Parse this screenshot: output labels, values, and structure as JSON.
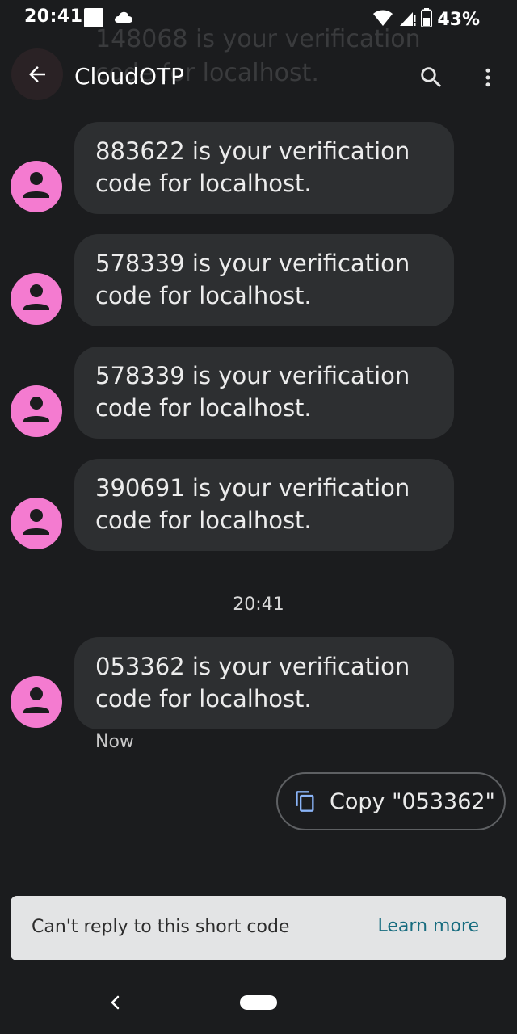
{
  "status_bar": {
    "time": "20:41",
    "battery_percent": "43%"
  },
  "background_notification": {
    "line1": "148068 is your verification",
    "line2": "code for localhost."
  },
  "app_bar": {
    "title": "CloudOTP"
  },
  "messages": [
    {
      "line1": "883622 is your verification",
      "line2": "code for localhost."
    },
    {
      "line1": "578339 is your verification",
      "line2": "code for localhost."
    },
    {
      "line1": "578339 is your verification",
      "line2": "code for localhost."
    },
    {
      "line1": "390691 is your verification",
      "line2": "code for localhost."
    },
    {
      "line1": "053362 is your verification",
      "line2": "code for localhost."
    }
  ],
  "timestamp_divider": "20:41",
  "last_message_status": "Now",
  "suggestion_chip": {
    "label": "Copy \"053362\""
  },
  "banner": {
    "text": "Can't reply to this short code",
    "link": "Learn more"
  },
  "colors": {
    "background": "#1b1c1e",
    "bubble": "#2d2f31",
    "avatar": "#f47bd0",
    "chip_icon": "#8ab4f8",
    "banner_bg": "#e3e4e5",
    "link": "#176c7f"
  }
}
